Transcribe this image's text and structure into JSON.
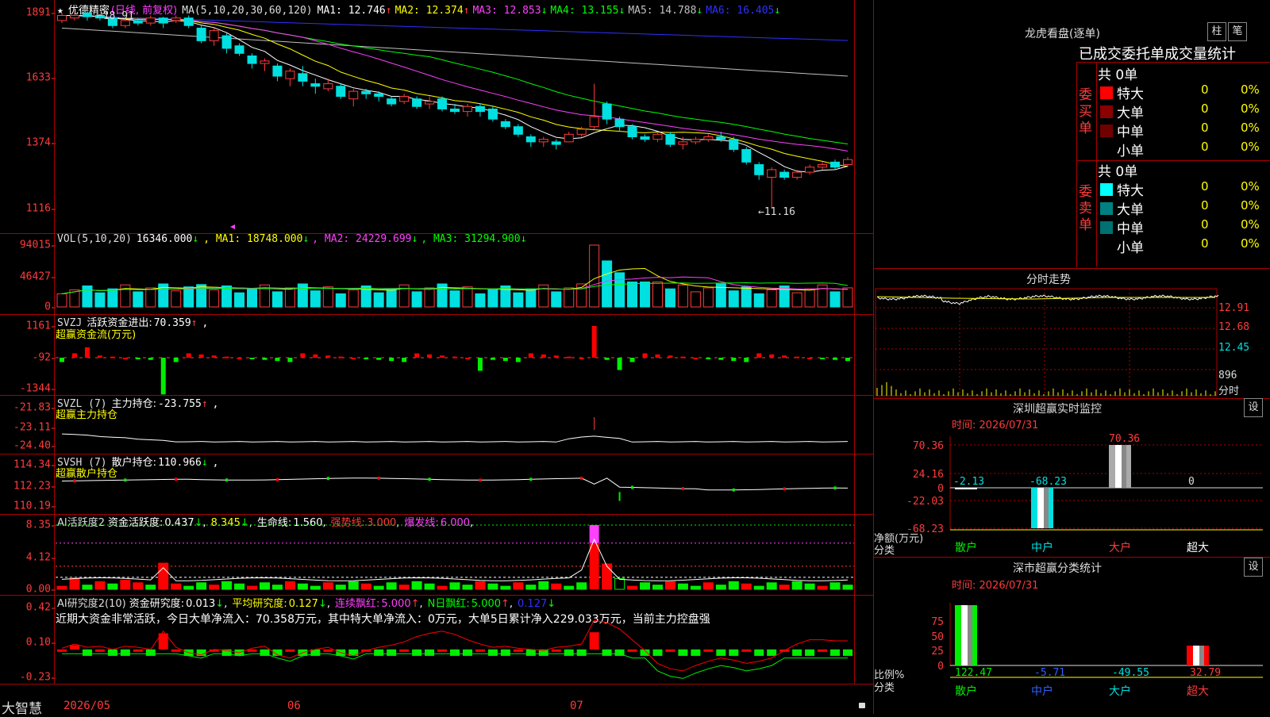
{
  "colors": {
    "up": "#ff3b3b",
    "down": "#00e0e0",
    "ma1": "#ffffff",
    "ma2": "#ffff00",
    "ma3": "#ff40ff",
    "ma4": "#00ff00",
    "ma5": "#c0c0c0",
    "ma6": "#3030ff",
    "grid": "#a00000",
    "text": "#ff3b3b"
  },
  "stock": {
    "name": "优德精密",
    "period": "(日线, 前复权)",
    "ma_label": "MA(5,10,20,30,60,120)",
    "ma": [
      {
        "label": "MA1:",
        "value": "12.746",
        "arrow": "↑"
      },
      {
        "label": "MA2:",
        "value": "12.374",
        "arrow": "↑"
      },
      {
        "label": "MA3:",
        "value": "12.853",
        "arrow": "↓"
      },
      {
        "label": "MA4:",
        "value": "13.155",
        "arrow": "↓"
      },
      {
        "label": "MA5:",
        "value": "14.788",
        "arrow": "↓"
      },
      {
        "label": "MA6:",
        "value": "16.405",
        "arrow": "↓"
      }
    ],
    "high_mark": "18.91",
    "low_mark": "←11.16"
  },
  "price_axis": [
    "1891",
    "1633",
    "1374",
    "1116"
  ],
  "vol": {
    "label": "VOL(5,10,20)",
    "value": "16346.000",
    "arrow": "↓",
    "ma": [
      {
        "label": "MA1:",
        "value": "18748.000",
        "arrow": "↓"
      },
      {
        "label": "MA2:",
        "value": "24229.699",
        "arrow": "↓"
      },
      {
        "label": "MA3:",
        "value": "31294.900",
        "arrow": "↓"
      }
    ],
    "axis": [
      "94015",
      "46427",
      "0"
    ]
  },
  "svzj": {
    "label": "SVZJ",
    "name": "活跃资金进出:",
    "value": "70.359",
    "arrow": "↑",
    "sub": "超赢资金流(万元)",
    "axis": [
      "1161",
      "-92",
      "-1344"
    ]
  },
  "svzl": {
    "label": "SVZL (7)",
    "name": "主力持仓:",
    "value": "-23.755",
    "arrow": "↑",
    "sub": "超赢主力持仓",
    "axis": [
      "-21.83",
      "-23.11",
      "-24.40"
    ]
  },
  "svsh": {
    "label": "SVSH (7)",
    "name": "散户持仓:",
    "value": "110.966",
    "arrow": "↓",
    "sub": "超赢散户持仓",
    "axis": [
      "114.34",
      "112.23",
      "110.19"
    ]
  },
  "ai1": {
    "label": "AI活跃度2",
    "name": "资金活跃度:",
    "value": "0.437",
    "arrow": "↓",
    "v2": "8.345",
    "a2": "↓",
    "life_label": "生命线:",
    "life": "1.560",
    "strong_label": "强势线:",
    "strong": "3.000",
    "burst_label": "爆发线:",
    "burst": "6.000",
    "axis": [
      "8.35",
      "4.12",
      "0.00"
    ]
  },
  "ai2": {
    "label": "AI研究度2(10)",
    "name": "资金研究度:",
    "value": "0.013",
    "arrow": "↓",
    "avg_label": "平均研究度:",
    "avg": "0.127",
    "avg_arrow": "↓",
    "red_label": "连续飘红:",
    "red": "5.000",
    "red_arrow": "↑",
    "n_label": "N日飘红:",
    "n": "5.000",
    "n_arrow": "↑",
    "last": "0.127",
    "last_arrow": "↓",
    "summary": "近期大资金非常活跃，今日大单净流入：70.358万元，其中特大单净流入：0万元，大单5日累计净入229.033万元，当前主力控盘强",
    "axis": [
      "0.42",
      "0.10",
      "-0.23"
    ]
  },
  "bottom": {
    "logo": "大智慧",
    "dates": [
      "2026/05",
      "06",
      "07"
    ]
  },
  "right": {
    "lhb_title": "龙虎看盘(逐单)",
    "btn1": "柱",
    "btn2": "笔",
    "head": "已成交委托单成交量统计",
    "buy_label": "委买单",
    "sell_label": "委卖单",
    "buy_total": "共 0单",
    "sell_total": "共 0单",
    "rows": [
      {
        "name": "特大",
        "count": "0",
        "pct": "0%"
      },
      {
        "name": "大单",
        "count": "0",
        "pct": "0%"
      },
      {
        "name": "中单",
        "count": "0",
        "pct": "0%"
      },
      {
        "name": "小单",
        "count": "0",
        "pct": "0%"
      }
    ],
    "buy_colors": [
      "#ff0000",
      "#8b0000",
      "#700000",
      ""
    ],
    "sell_colors": [
      "#00ffff",
      "#008080",
      "#007070",
      ""
    ],
    "fenshi_title": "分时走势",
    "fenshi_axis": [
      "12.91",
      "12.68",
      "12.45"
    ],
    "fenshi_vol": "896",
    "fenshi_label": "分时",
    "sz_title": "深圳超赢实时监控",
    "set_btn": "设",
    "sz_time": "时间: 2026/07/31",
    "sz_axis": [
      "70.36",
      "24.16",
      "0",
      "-22.03",
      "-68.23"
    ],
    "sz_values": {
      "散户": "-2.13",
      "中户": "-68.23",
      "大户": "70.36",
      "超大": "0"
    },
    "sz_ylabel": "净额(万元)",
    "sz_xlabel": "分类",
    "cats": [
      "散户",
      "中户",
      "大户",
      "超大"
    ],
    "fl_title": "深市超赢分类统计",
    "fl_time": "时间: 2026/07/31",
    "fl_axis": [
      "75",
      "50",
      "25",
      "0"
    ],
    "fl_values": [
      "122.47",
      "-5.71",
      "-49.55",
      "32.79"
    ],
    "fl_ylabel": "比例%",
    "fl_xlabel": "分类"
  },
  "chart_data": {
    "type": "candlestick",
    "dates_visible": [
      "2026/05",
      "06",
      "07"
    ],
    "candles": [
      [
        18.6,
        18.8,
        18.9,
        18.5
      ],
      [
        18.7,
        18.8,
        18.91,
        18.6
      ],
      [
        18.9,
        18.75,
        18.9,
        18.6
      ],
      [
        18.8,
        18.7,
        18.85,
        18.6
      ],
      [
        18.7,
        18.4,
        18.75,
        18.3
      ],
      [
        18.4,
        18.6,
        18.7,
        18.3
      ],
      [
        18.6,
        18.5,
        18.7,
        18.4
      ],
      [
        18.5,
        18.7,
        18.8,
        18.4
      ],
      [
        18.7,
        18.5,
        18.75,
        18.3
      ],
      [
        18.6,
        18.7,
        18.8,
        18.5
      ],
      [
        18.7,
        18.4,
        18.8,
        18.3
      ],
      [
        18.3,
        17.8,
        18.4,
        17.7
      ],
      [
        17.8,
        18.2,
        18.3,
        17.6
      ],
      [
        18.0,
        17.5,
        18.1,
        17.3
      ],
      [
        17.6,
        17.3,
        17.7,
        17.2
      ],
      [
        17.2,
        16.9,
        17.3,
        16.7
      ],
      [
        16.9,
        17.0,
        17.1,
        16.6
      ],
      [
        16.8,
        16.4,
        16.9,
        16.2
      ],
      [
        16.3,
        16.6,
        16.7,
        16.0
      ],
      [
        16.5,
        16.2,
        16.8,
        16.0
      ],
      [
        16.1,
        16.0,
        16.3,
        15.7
      ],
      [
        15.9,
        16.1,
        16.3,
        15.8
      ],
      [
        16.0,
        15.6,
        16.1,
        15.5
      ],
      [
        15.5,
        15.8,
        15.9,
        15.2
      ],
      [
        15.8,
        15.7,
        15.9,
        15.5
      ],
      [
        15.7,
        15.6,
        15.8,
        15.4
      ],
      [
        15.5,
        15.3,
        15.6,
        15.2
      ],
      [
        15.4,
        15.6,
        15.7,
        15.3
      ],
      [
        15.5,
        15.2,
        15.6,
        15.1
      ],
      [
        15.3,
        15.4,
        15.6,
        15.1
      ],
      [
        15.5,
        15.1,
        15.6,
        15.0
      ],
      [
        15.1,
        15.0,
        15.3,
        14.9
      ],
      [
        15.0,
        15.2,
        15.3,
        14.8
      ],
      [
        15.2,
        15.0,
        15.3,
        14.8
      ],
      [
        15.1,
        14.7,
        15.2,
        14.6
      ],
      [
        14.6,
        14.4,
        14.7,
        14.3
      ],
      [
        14.4,
        14.1,
        14.5,
        14.0
      ],
      [
        14.0,
        13.8,
        14.1,
        13.6
      ],
      [
        13.8,
        13.9,
        14.0,
        13.6
      ],
      [
        13.8,
        13.7,
        13.9,
        13.5
      ],
      [
        13.8,
        14.1,
        14.2,
        13.9
      ],
      [
        14.1,
        14.3,
        14.4,
        14.0
      ],
      [
        14.4,
        14.8,
        16.1,
        14.3
      ],
      [
        15.3,
        14.7,
        15.4,
        14.5
      ],
      [
        14.7,
        14.4,
        14.8,
        14.2
      ],
      [
        14.4,
        14.0,
        14.5,
        13.9
      ],
      [
        14.0,
        13.9,
        14.1,
        13.8
      ],
      [
        13.9,
        14.1,
        14.2,
        13.8
      ],
      [
        14.1,
        13.7,
        14.2,
        13.6
      ],
      [
        13.7,
        13.8,
        14.0,
        13.5
      ],
      [
        13.8,
        13.9,
        14.0,
        13.7
      ],
      [
        13.9,
        14.0,
        14.1,
        13.8
      ],
      [
        14.0,
        13.9,
        14.2,
        13.8
      ],
      [
        13.9,
        13.5,
        14.0,
        13.4
      ],
      [
        13.5,
        13.0,
        13.6,
        12.9
      ],
      [
        12.9,
        12.5,
        13.0,
        12.3
      ],
      [
        12.4,
        12.7,
        12.8,
        11.16
      ],
      [
        12.6,
        12.4,
        12.7,
        12.3
      ],
      [
        12.4,
        12.6,
        12.7,
        12.3
      ],
      [
        12.6,
        12.8,
        12.9,
        12.5
      ],
      [
        12.8,
        12.9,
        13.0,
        12.7
      ],
      [
        13.0,
        12.8,
        13.1,
        12.7
      ],
      [
        12.9,
        13.1,
        13.2,
        12.8
      ]
    ],
    "ylim": [
      11.16,
      18.91
    ]
  }
}
